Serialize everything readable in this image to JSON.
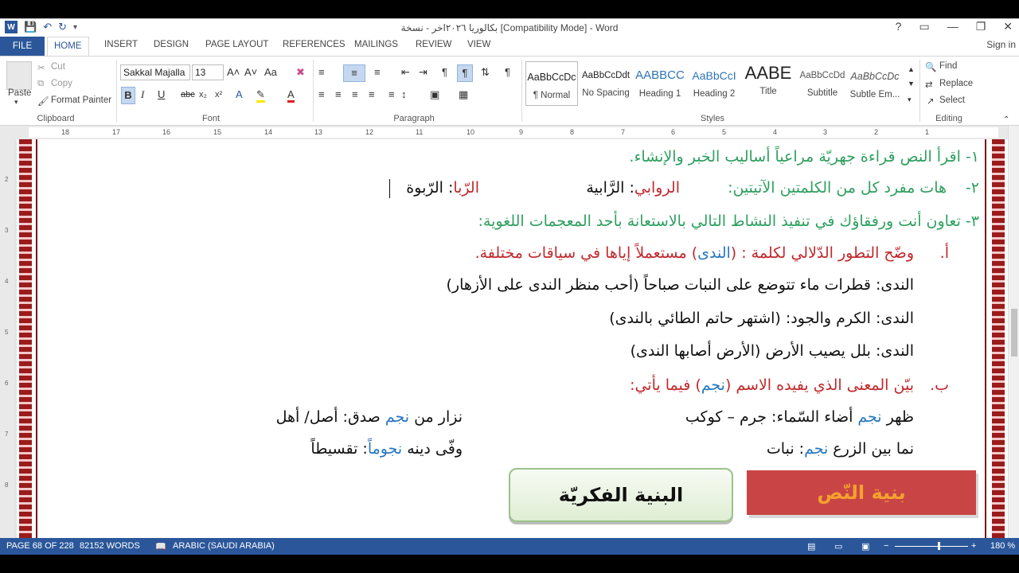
{
  "window": {
    "title": "بكالوريا ٢٠٢٦اخر - نسخة [Compatibility Mode] - Word",
    "help": "?",
    "controls": [
      "▭",
      "—",
      "❐",
      "✕"
    ]
  },
  "tabs": {
    "file": "FILE",
    "items": [
      "HOME",
      "INSERT",
      "DESIGN",
      "PAGE LAYOUT",
      "REFERENCES",
      "MAILINGS",
      "REVIEW",
      "VIEW"
    ],
    "active": "HOME",
    "sign_in": "Sign in"
  },
  "ribbon": {
    "clipboard": {
      "paste": "Paste",
      "cut": "Cut",
      "copy": "Copy",
      "format_painter": "Format Painter",
      "label": "Clipboard"
    },
    "font": {
      "name": "Sakkal Majalla",
      "size": "13",
      "label": "Font",
      "bold": "B",
      "italic": "I",
      "underline": "U",
      "strike": "abc",
      "sub": "x₂",
      "sup": "x²",
      "grow": "A˄",
      "shrink": "A˅",
      "case": "Aa"
    },
    "paragraph": {
      "label": "Paragraph"
    },
    "styles": {
      "label": "Styles",
      "items": [
        {
          "preview": "AaBbCcDc",
          "name": "¶ Normal"
        },
        {
          "preview": "AaBbCcDdt",
          "name": "No Spacing"
        },
        {
          "preview": "AABBCC",
          "name": "Heading 1"
        },
        {
          "preview": "AaBbCcI",
          "name": "Heading 2"
        },
        {
          "preview": "AABE",
          "name": "Title"
        },
        {
          "preview": "AaBbCcDd",
          "name": "Subtitle"
        },
        {
          "preview": "AaBbCcDc",
          "name": "Subtle Em..."
        }
      ]
    },
    "editing": {
      "find": "Find",
      "replace": "Replace",
      "select": "Select",
      "label": "Editing"
    }
  },
  "ruler": {
    "numbers": [
      "18",
      "17",
      "16",
      "15",
      "14",
      "13",
      "12",
      "11",
      "10",
      "9",
      "8",
      "7",
      "6",
      "5",
      "4",
      "3",
      "2",
      "1"
    ]
  },
  "vruler": {
    "numbers": [
      "1",
      "2",
      "3",
      "4",
      "5",
      "6",
      "7",
      "8"
    ]
  },
  "document": {
    "line1": "١- اقرأ النص قراءة جهريّة مراعياً أساليب الخبر والإنشاء.",
    "line2": {
      "num": "٢-",
      "prompt": "هات مفرد كل من الكلمتين الآتيتين:",
      "word1": "الروابي",
      "answer1": ": الرَّابية",
      "word2": "الرّبا",
      "answer2": ": الرّبوة"
    },
    "line3": "٣- تعاون أنت ورفقاؤك في تنفيذ النشاط التالي بالاستعانة بأحد المعجمات اللغوية:",
    "task_a": {
      "letter": "أ.",
      "pre": "وضّح التطور الدّلالي لكلمة : (",
      "word": "الندى",
      "post": ") مستعملاً إياها في سياقات مختلفة."
    },
    "nada1": "الندى: قطرات ماء تتوضع على النبات صباحاً (أحب منظر الندى على الأزهار)",
    "nada2": "الندى: الكرم والجود: (اشتهر حاتم الطائي بالندى)",
    "nada3": "الندى: بلل يصيب الأرض (الأرض أصابها الندى)",
    "task_b": {
      "letter": "ب.",
      "pre": "بيّن المعنى الذي يفيده الاسم (",
      "word": "نجم",
      "post": ") فيما يأتي:"
    },
    "ex1": {
      "pre": "ظهر ",
      "word": "نجم",
      "post": " أضاء السّماء: جرم – كوكب"
    },
    "ex2": {
      "pre": "نزار من ",
      "word": "نجم",
      "post": " صدق: أصل/ أهل"
    },
    "ex3": {
      "pre": "نما بين الزرع ",
      "word": "نجم",
      "post": ": نبات"
    },
    "ex4": {
      "pre": "وفّى دينه ",
      "word": "نجوماً",
      "post": ": تقسيطاً"
    },
    "btn_green": "البنية الفكريّة",
    "btn_red": "بنية النّص"
  },
  "status": {
    "page": "PAGE 68 OF 228",
    "words": "82152 WORDS",
    "language": "ARABIC (SAUDI ARABIA)",
    "zoom": "180 %",
    "zoom_minus": "−",
    "zoom_plus": "+"
  }
}
